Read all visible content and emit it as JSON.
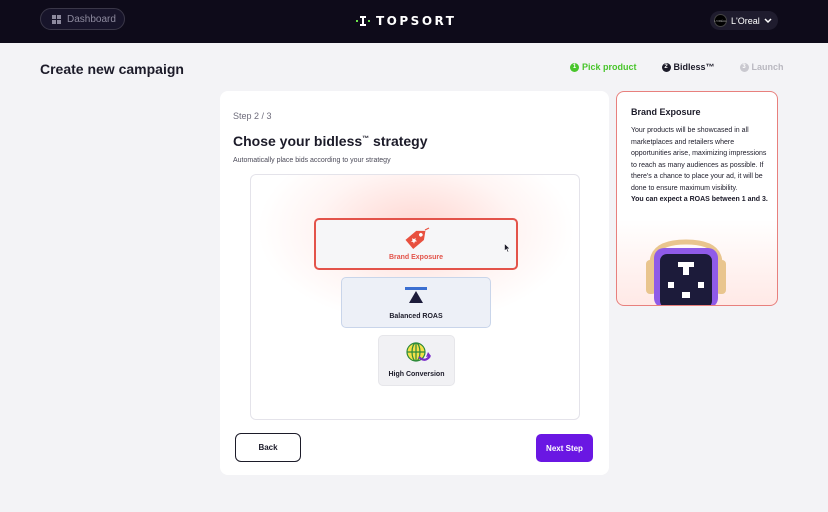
{
  "topbar": {
    "dashboard_label": "Dashboard",
    "logo_text": "TOPSORT",
    "account_name": "L'Oreal",
    "account_avatar_text": "L'ORÉAL"
  },
  "header": {
    "title": "Create new campaign",
    "steps": [
      {
        "number": "1",
        "label": "Pick product",
        "state": "done"
      },
      {
        "number": "2",
        "label": "Bidless™",
        "state": "active"
      },
      {
        "number": "3",
        "label": "Launch",
        "state": "todo"
      }
    ]
  },
  "card": {
    "step_label": "Step 2 / 3",
    "title": "Chose your bidless",
    "title_tm": "™",
    "title_suffix": " strategy",
    "subtitle": "Automatically place bids according to your strategy",
    "options": [
      {
        "label": "Brand Exposure",
        "icon": "tag-icon",
        "selected": true
      },
      {
        "label": "Balanced ROAS",
        "icon": "balance-icon",
        "selected": false
      },
      {
        "label": "High Conversion",
        "icon": "globe-target-icon",
        "selected": false
      }
    ],
    "back_label": "Back",
    "next_label": "Next Step"
  },
  "info": {
    "title": "Brand Exposure",
    "body": "Your products will be showcased in all marketplaces and retailers where opportunities arise, maximizing impressions to reach as many audiences as possible. If there's a chance to place your ad, it will be done to ensure maximum visibility.",
    "highlight": "You can expect a ROAS between 1 and 3."
  },
  "colors": {
    "accent_purple": "#6a17e3",
    "selected_red": "#e3534a",
    "done_green": "#49c52c",
    "topbar_bg": "#0e0b1a"
  }
}
